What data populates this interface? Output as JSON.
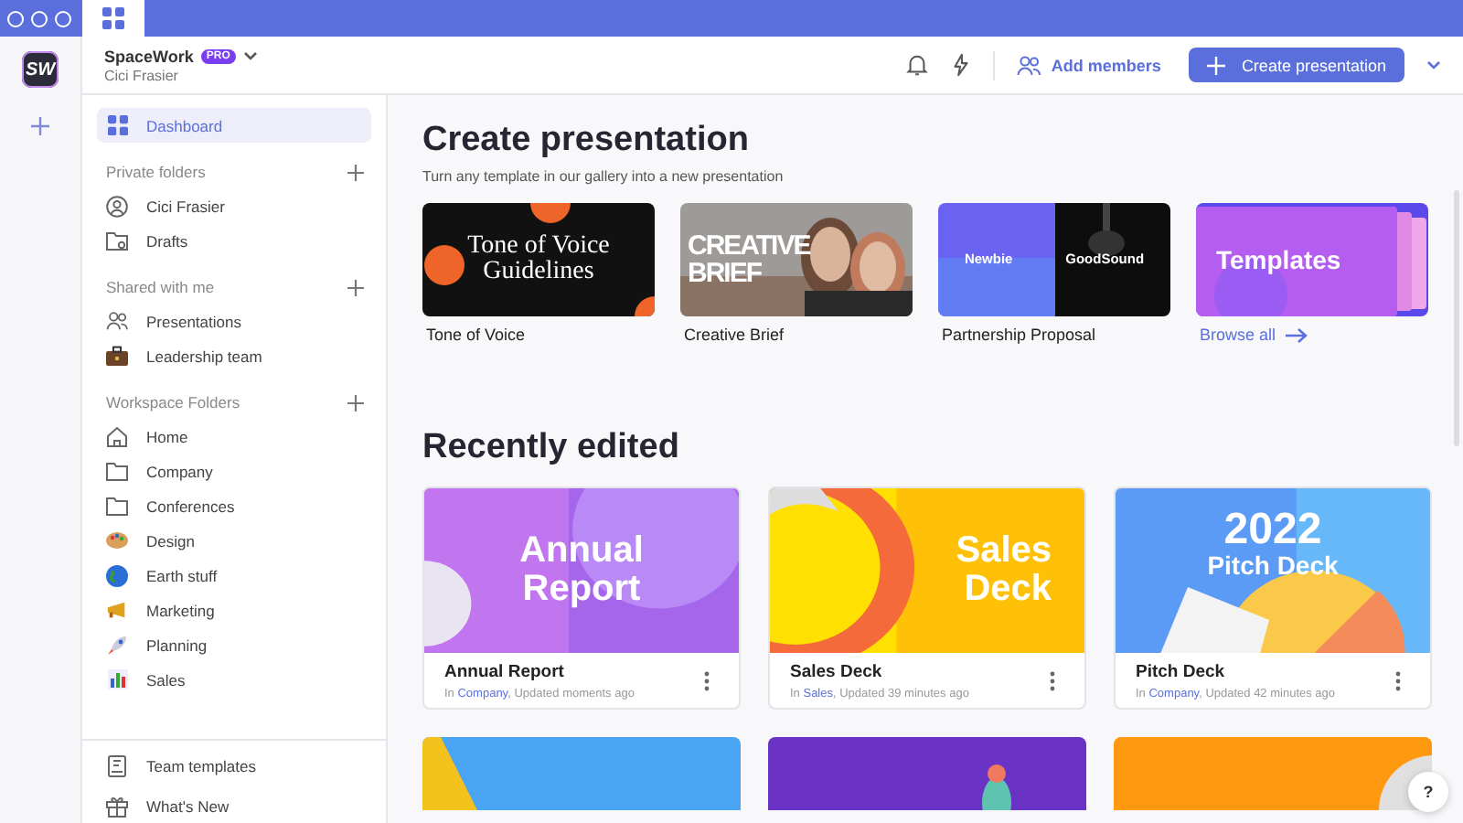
{
  "app": {
    "logo": "SW"
  },
  "workspace": {
    "name": "SpaceWork",
    "badge": "PRO",
    "user": "Cici Frasier"
  },
  "header": {
    "add_members": "Add members",
    "create": "Create presentation"
  },
  "sidebar": {
    "sections": [
      {
        "items": [
          {
            "label": "Dashboard",
            "selected": true
          }
        ]
      },
      {
        "title": "Private folders",
        "items": [
          {
            "label": "Cici Frasier",
            "selected": false
          },
          {
            "label": "Drafts",
            "selected": false
          }
        ]
      },
      {
        "title": "Shared with me",
        "items": [
          {
            "label": "Presentations",
            "selected": false
          },
          {
            "label": "Leadership team",
            "selected": false
          }
        ]
      },
      {
        "title": "Workspace Folders",
        "items": [
          {
            "label": "Home",
            "selected": false
          },
          {
            "label": "Company",
            "selected": false
          },
          {
            "label": "Conferences",
            "selected": false
          },
          {
            "label": "Design",
            "selected": false
          },
          {
            "label": "Earth stuff",
            "selected": false
          },
          {
            "label": "Marketing",
            "selected": false
          },
          {
            "label": "Planning",
            "selected": false
          },
          {
            "label": "Sales",
            "selected": false
          }
        ]
      }
    ],
    "footer": [
      {
        "label": "Team templates",
        "selected": false
      },
      {
        "label": "What's New",
        "selected": false
      }
    ]
  },
  "create": {
    "title": "Create presentation",
    "subtitle": "Turn any template in our gallery into a new presentation",
    "templates": [
      {
        "label": "Tone of Voice",
        "thumb_text": [
          "Tone of Voice",
          "Guidelines"
        ],
        "kind": "template"
      },
      {
        "label": "Creative Brief",
        "thumb_text": [
          "CREATIVE",
          "BRIEF"
        ],
        "kind": "template"
      },
      {
        "label": "Partnership Proposal",
        "thumb_text": [
          "Newbie",
          "GoodSound"
        ],
        "kind": "template"
      },
      {
        "label": "Browse all",
        "thumb_text": [
          "Templates"
        ],
        "kind": "link"
      }
    ]
  },
  "recent": {
    "title": "Recently edited",
    "cards": [
      {
        "title": "Annual Report",
        "prefix": "In ",
        "folder": "Company",
        "updated": ", Updated moments ago",
        "thumb_text": [
          "Annual",
          "Report"
        ]
      },
      {
        "title": "Sales Deck",
        "prefix": "In ",
        "folder": "Sales",
        "updated": ", Updated 39 minutes ago",
        "thumb_text": [
          "Sales",
          "Deck"
        ]
      },
      {
        "title": "Pitch Deck",
        "prefix": "In ",
        "folder": "Company",
        "updated": ", Updated 42 minutes ago",
        "thumb_text": [
          "2022",
          "Pitch Deck"
        ]
      }
    ]
  },
  "help": "?"
}
